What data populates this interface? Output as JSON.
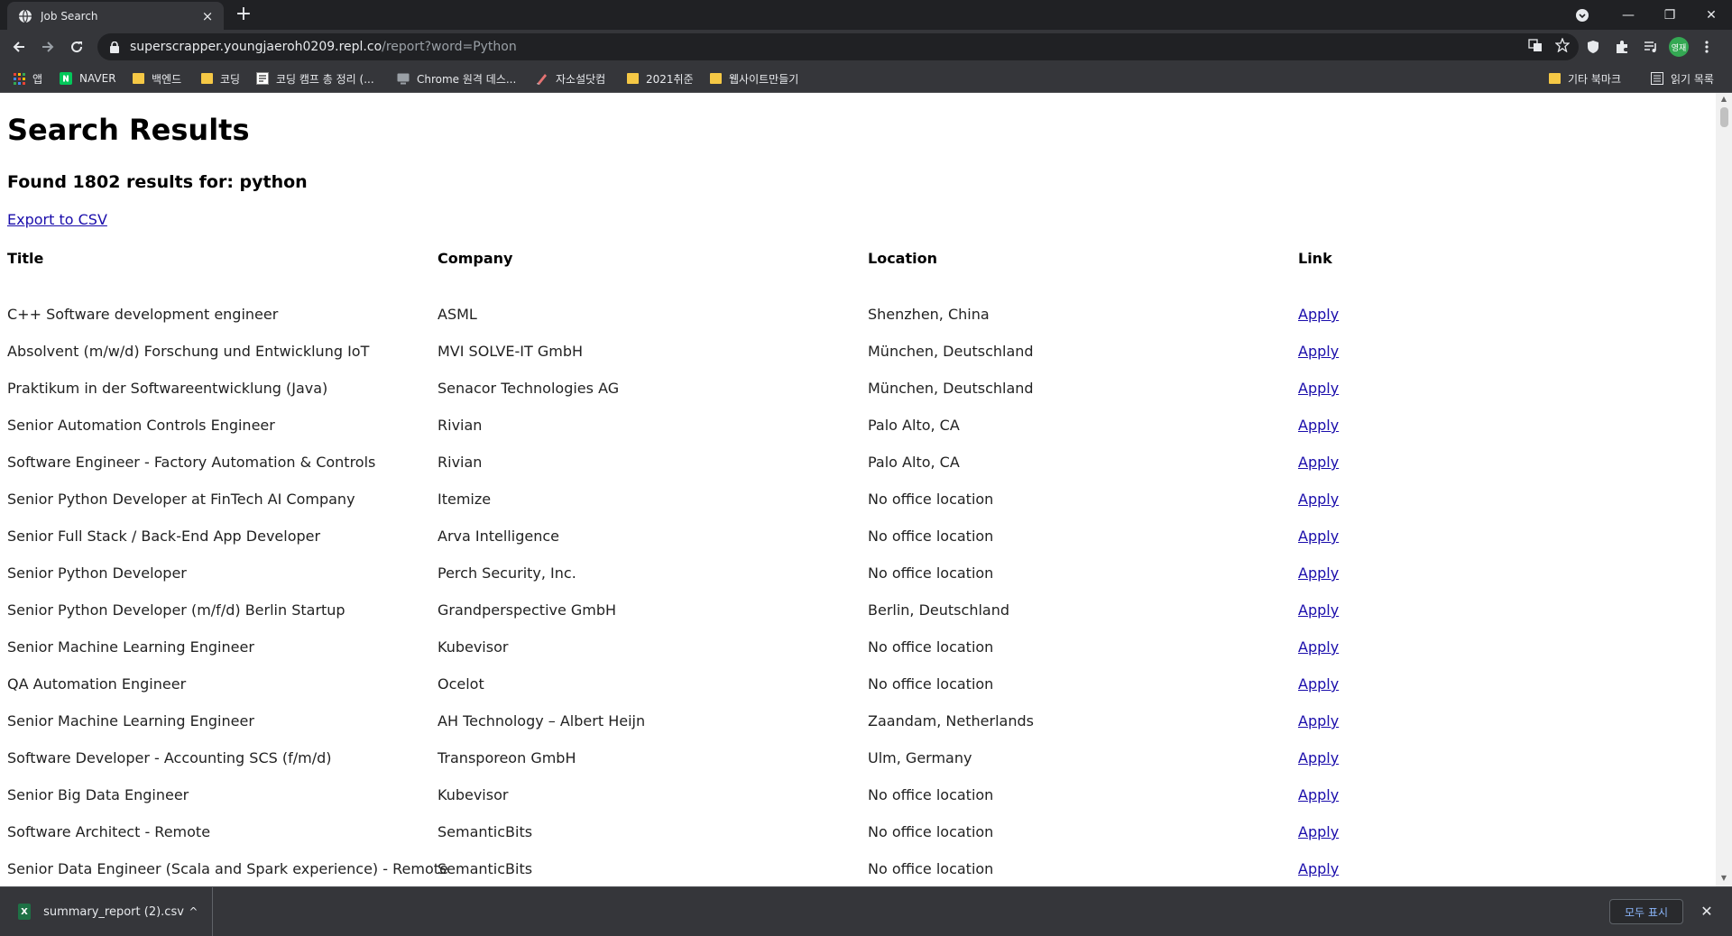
{
  "browser": {
    "tab_title": "Job Search",
    "tab_close": "×",
    "new_tab": "+",
    "url_host": "superscrapper.youngjaeroh0209.repl.co",
    "url_path": "/report?word=Python",
    "profile_label": "영재",
    "window_controls": {
      "minimize": "—",
      "restore": "❐",
      "close": "✕"
    }
  },
  "bookmarks": {
    "items": [
      {
        "label": "앱",
        "icon": "apps-grid-icon"
      },
      {
        "label": "NAVER",
        "icon": "naver-icon"
      },
      {
        "label": "백엔드",
        "icon": "folder-icon"
      },
      {
        "label": "코딩",
        "icon": "folder-icon"
      },
      {
        "label": "코딩 캠프 총 정리 (...",
        "icon": "page-icon"
      },
      {
        "label": "Chrome 원격 데스...",
        "icon": "remote-desktop-icon"
      },
      {
        "label": "자소설닷컴",
        "icon": "pen-icon"
      },
      {
        "label": "2021취준",
        "icon": "folder-icon"
      },
      {
        "label": "웹사이트만들기",
        "icon": "folder-icon"
      }
    ],
    "other_bookmarks": "기타 북마크",
    "reading_list": "읽기 목록"
  },
  "page": {
    "heading": "Search Results",
    "summary": "Found 1802 results for: python",
    "export_link": "Export to CSV",
    "columns": [
      "Title",
      "Company",
      "Location",
      "Link"
    ],
    "rows": [
      {
        "title": "C++ Software development engineer",
        "company": "ASML",
        "location": "Shenzhen, China",
        "link": "Apply"
      },
      {
        "title": "Absolvent (m/w/d) Forschung und Entwicklung IoT",
        "company": "MVI SOLVE-IT GmbH",
        "location": "München, Deutschland",
        "link": "Apply"
      },
      {
        "title": "Praktikum in der Softwareentwicklung (Java)",
        "company": "Senacor Technologies AG",
        "location": "München, Deutschland",
        "link": "Apply"
      },
      {
        "title": "Senior Automation Controls Engineer",
        "company": "Rivian",
        "location": "Palo Alto, CA",
        "link": "Apply"
      },
      {
        "title": "Software Engineer - Factory Automation & Controls",
        "company": "Rivian",
        "location": "Palo Alto, CA",
        "link": "Apply"
      },
      {
        "title": "Senior Python Developer at FinTech AI Company",
        "company": "Itemize",
        "location": "No office location",
        "link": "Apply"
      },
      {
        "title": "Senior Full Stack / Back-End App Developer",
        "company": "Arva Intelligence",
        "location": "No office location",
        "link": "Apply"
      },
      {
        "title": "Senior Python Developer",
        "company": "Perch Security, Inc.",
        "location": "No office location",
        "link": "Apply"
      },
      {
        "title": "Senior Python Developer (m/f/d) Berlin Startup",
        "company": "Grandperspective GmbH",
        "location": "Berlin, Deutschland",
        "link": "Apply"
      },
      {
        "title": "Senior Machine Learning Engineer",
        "company": "Kubevisor",
        "location": "No office location",
        "link": "Apply"
      },
      {
        "title": "QA Automation Engineer",
        "company": "Ocelot",
        "location": "No office location",
        "link": "Apply"
      },
      {
        "title": "Senior Machine Learning Engineer",
        "company": "AH Technology – Albert Heijn",
        "location": "Zaandam, Netherlands",
        "link": "Apply"
      },
      {
        "title": "Software Developer - Accounting SCS (f/m/d)",
        "company": "Transporeon GmbH",
        "location": "Ulm, Germany",
        "link": "Apply"
      },
      {
        "title": "Senior Big Data Engineer",
        "company": "Kubevisor",
        "location": "No office location",
        "link": "Apply"
      },
      {
        "title": "Software Architect - Remote",
        "company": "SemanticBits",
        "location": "No office location",
        "link": "Apply"
      },
      {
        "title": "Senior Data Engineer (Scala and Spark experience) - Remote",
        "company": "SemanticBits",
        "location": "No office location",
        "link": "Apply"
      }
    ]
  },
  "downloads": {
    "file_name": "summary_report (2).csv",
    "file_icon": "excel-icon",
    "show_all": "모두 표시",
    "close": "✕"
  }
}
